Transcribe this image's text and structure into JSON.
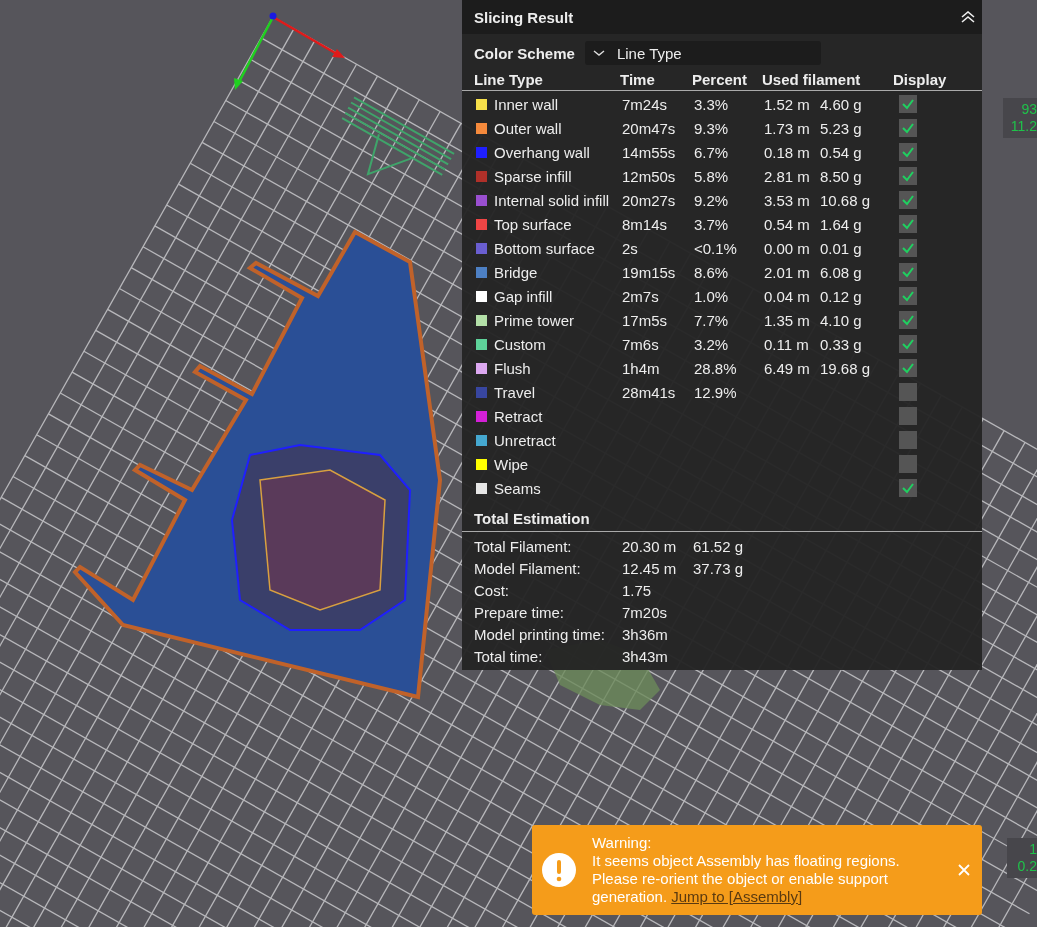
{
  "viewport": {
    "readouts": [
      {
        "lines": [
          "93",
          "11.2"
        ]
      },
      {
        "lines": [
          "1",
          "0.2"
        ]
      }
    ]
  },
  "panel": {
    "title": "Slicing Result",
    "color_scheme": {
      "label": "Color Scheme",
      "value": "Line Type"
    },
    "columns": [
      "Line Type",
      "Time",
      "Percent",
      "Used filament",
      "Display"
    ],
    "rows": [
      {
        "name": "Inner wall",
        "color": "#f7e04a",
        "time": "7m24s",
        "percent": "3.3%",
        "length": "1.52 m",
        "weight": "4.60 g",
        "checked": true
      },
      {
        "name": "Outer wall",
        "color": "#f58a3c",
        "time": "20m47s",
        "percent": "9.3%",
        "length": "1.73 m",
        "weight": "5.23 g",
        "checked": true
      },
      {
        "name": "Overhang wall",
        "color": "#1f1fff",
        "time": "14m55s",
        "percent": "6.7%",
        "length": "0.18 m",
        "weight": "0.54 g",
        "checked": true
      },
      {
        "name": "Sparse infill",
        "color": "#b03029",
        "time": "12m50s",
        "percent": "5.8%",
        "length": "2.81 m",
        "weight": "8.50 g",
        "checked": true
      },
      {
        "name": "Internal solid infill",
        "color": "#9a4fd0",
        "time": "20m27s",
        "percent": "9.2%",
        "length": "3.53 m",
        "weight": "10.68 g",
        "checked": true
      },
      {
        "name": "Top surface",
        "color": "#f04545",
        "time": "8m14s",
        "percent": "3.7%",
        "length": "0.54 m",
        "weight": "1.64 g",
        "checked": true
      },
      {
        "name": "Bottom surface",
        "color": "#6a5ed0",
        "time": "2s",
        "percent": "<0.1%",
        "length": "0.00 m",
        "weight": "0.01 g",
        "checked": true
      },
      {
        "name": "Bridge",
        "color": "#4d80c4",
        "time": "19m15s",
        "percent": "8.6%",
        "length": "2.01 m",
        "weight": "6.08 g",
        "checked": true
      },
      {
        "name": "Gap infill",
        "color": "#ffffff",
        "time": "2m7s",
        "percent": "1.0%",
        "length": "0.04 m",
        "weight": "0.12 g",
        "checked": true
      },
      {
        "name": "Prime tower",
        "color": "#b3e0a8",
        "time": "17m5s",
        "percent": "7.7%",
        "length": "1.35 m",
        "weight": "4.10 g",
        "checked": true
      },
      {
        "name": "Custom",
        "color": "#5ed39a",
        "time": "7m6s",
        "percent": "3.2%",
        "length": "0.11 m",
        "weight": "0.33 g",
        "checked": true
      },
      {
        "name": "Flush",
        "color": "#dca8f0",
        "time": "1h4m",
        "percent": "28.8%",
        "length": "6.49 m",
        "weight": "19.68 g",
        "checked": true
      },
      {
        "name": "Travel",
        "color": "#3846a0",
        "time": "28m41s",
        "percent": "12.9%",
        "checked": false
      },
      {
        "name": "Retract",
        "color": "#d420d8",
        "checked": false
      },
      {
        "name": "Unretract",
        "color": "#45a8d0",
        "checked": false
      },
      {
        "name": "Wipe",
        "color": "#ffff00",
        "checked": false
      },
      {
        "name": "Seams",
        "color": "#e6e6e6",
        "checked": true
      }
    ]
  },
  "total_estimation": {
    "title": "Total Estimation",
    "rows": [
      {
        "label": "Total Filament:",
        "values": [
          "20.30 m",
          "61.52 g"
        ]
      },
      {
        "label": "Model Filament:",
        "values": [
          "12.45 m",
          "37.73 g"
        ]
      },
      {
        "label": "Cost:",
        "values": [
          "1.75"
        ]
      },
      {
        "label": "Prepare time:",
        "values": [
          "7m20s"
        ]
      },
      {
        "label": "Model printing time:",
        "values": [
          "3h36m"
        ]
      },
      {
        "label": "Total time:",
        "values": [
          "3h43m"
        ]
      }
    ]
  },
  "toast": {
    "title": "Warning:",
    "message": "It seems object Assembly has floating regions. Please re-orient the object or enable support generation.",
    "link": "Jump to [Assembly]"
  }
}
